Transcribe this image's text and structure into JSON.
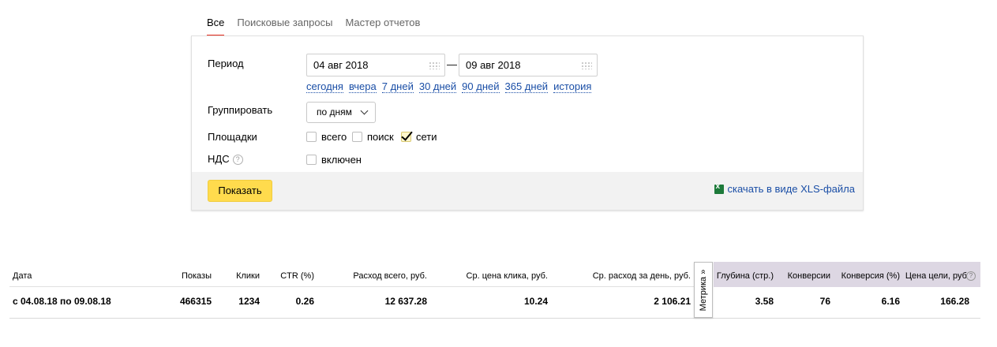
{
  "tabs": [
    {
      "label": "Все",
      "active": true
    },
    {
      "label": "Поисковые запросы",
      "active": false
    },
    {
      "label": "Мастер отчетов",
      "active": false
    }
  ],
  "form": {
    "period_label": "Период",
    "date_from": "04 авг 2018",
    "date_to": "09 авг 2018",
    "dash": "—",
    "quick_ranges": [
      "сегодня",
      "вчера",
      "7 дней",
      "30 дней",
      "90 дней",
      "365 дней",
      "история"
    ],
    "group_label": "Группировать",
    "group_value": "по дням",
    "platforms_label": "Площадки",
    "platforms": [
      {
        "label": "всего",
        "checked": false
      },
      {
        "label": "поиск",
        "checked": false
      },
      {
        "label": "сети",
        "checked": true
      }
    ],
    "vat_label": "НДС",
    "vat_help": "?",
    "vat_option": {
      "label": "включен",
      "checked": false
    },
    "show_button": "Показать",
    "xls_link": "скачать в виде XLS-файла"
  },
  "table": {
    "metrika_tab": "Метрика »",
    "help_icon": "?",
    "columns": [
      "Дата",
      "Показы",
      "Клики",
      "CTR (%)",
      "Расход всего, руб.",
      "Ср. цена клика, руб.",
      "Ср. расход за день, руб.",
      "Глубина (стр.)",
      "Конверсии",
      "Конверсия (%)",
      "Цена цели, руб."
    ],
    "row": [
      "с 04.08.18 по 09.08.18",
      "466315",
      "1234",
      "0.26",
      "12 637.28",
      "10.24",
      "2 106.21",
      "3.58",
      "76",
      "6.16",
      "166.28"
    ]
  },
  "colors": {
    "accent_tab": "#e52b1c",
    "button": "#ffdb4d",
    "link": "#1a4ea6",
    "metrika_header": "#ddd7e3"
  }
}
